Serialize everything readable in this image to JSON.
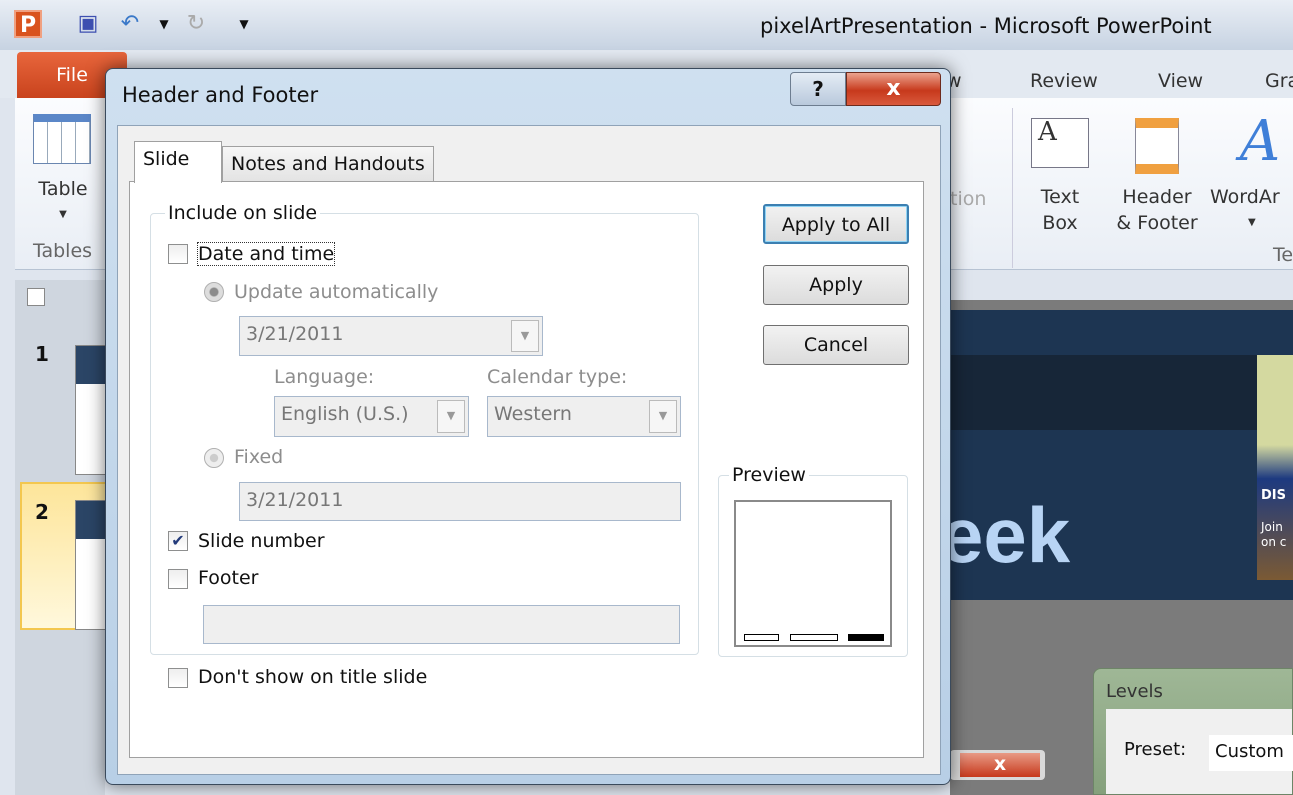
{
  "app": {
    "title": "pixelArtPresentation  -  Microsoft PowerPoint",
    "file_tab": "File",
    "ribbon_tabs": [
      "w",
      "Review",
      "View",
      "Gra"
    ],
    "ribbon": {
      "table": "Table",
      "tables_group": "Tables",
      "action_partial": "tion",
      "text_box": [
        "Text",
        "Box"
      ],
      "header_footer": [
        "Header",
        "& Footer"
      ],
      "wordart": "WordAr",
      "group_partial": "Te"
    },
    "slides": [
      "1",
      "2"
    ],
    "slide_text": "eek",
    "slide_badge": "DIS",
    "slide_badge_sub": [
      "Join",
      "on c"
    ],
    "levels": {
      "title": "Levels",
      "preset_label": "Preset:",
      "preset_value": "Custom"
    }
  },
  "dialog": {
    "title": "Header and Footer",
    "help": "?",
    "close": "x",
    "tabs": [
      {
        "label": "Slide",
        "selected": true
      },
      {
        "label": "Notes and Handouts",
        "selected": false
      }
    ],
    "include_group": "Include on slide",
    "date_time": {
      "label": "Date and time",
      "checked": false
    },
    "update_auto": {
      "label": "Update automatically",
      "selected": true,
      "value": "3/21/2011"
    },
    "language": {
      "label": "Language:",
      "value": "English (U.S.)"
    },
    "calendar": {
      "label": "Calendar type:",
      "value": "Western"
    },
    "fixed": {
      "label": "Fixed",
      "selected": false,
      "value": "3/21/2011"
    },
    "slide_number": {
      "label": "Slide number",
      "checked": true
    },
    "footer": {
      "label": "Footer",
      "checked": false,
      "value": ""
    },
    "dont_show_title": {
      "label": "Don't show on title slide",
      "checked": false
    },
    "buttons": {
      "apply_all": "Apply to All",
      "apply": "Apply",
      "cancel": "Cancel"
    },
    "preview_label": "Preview"
  }
}
